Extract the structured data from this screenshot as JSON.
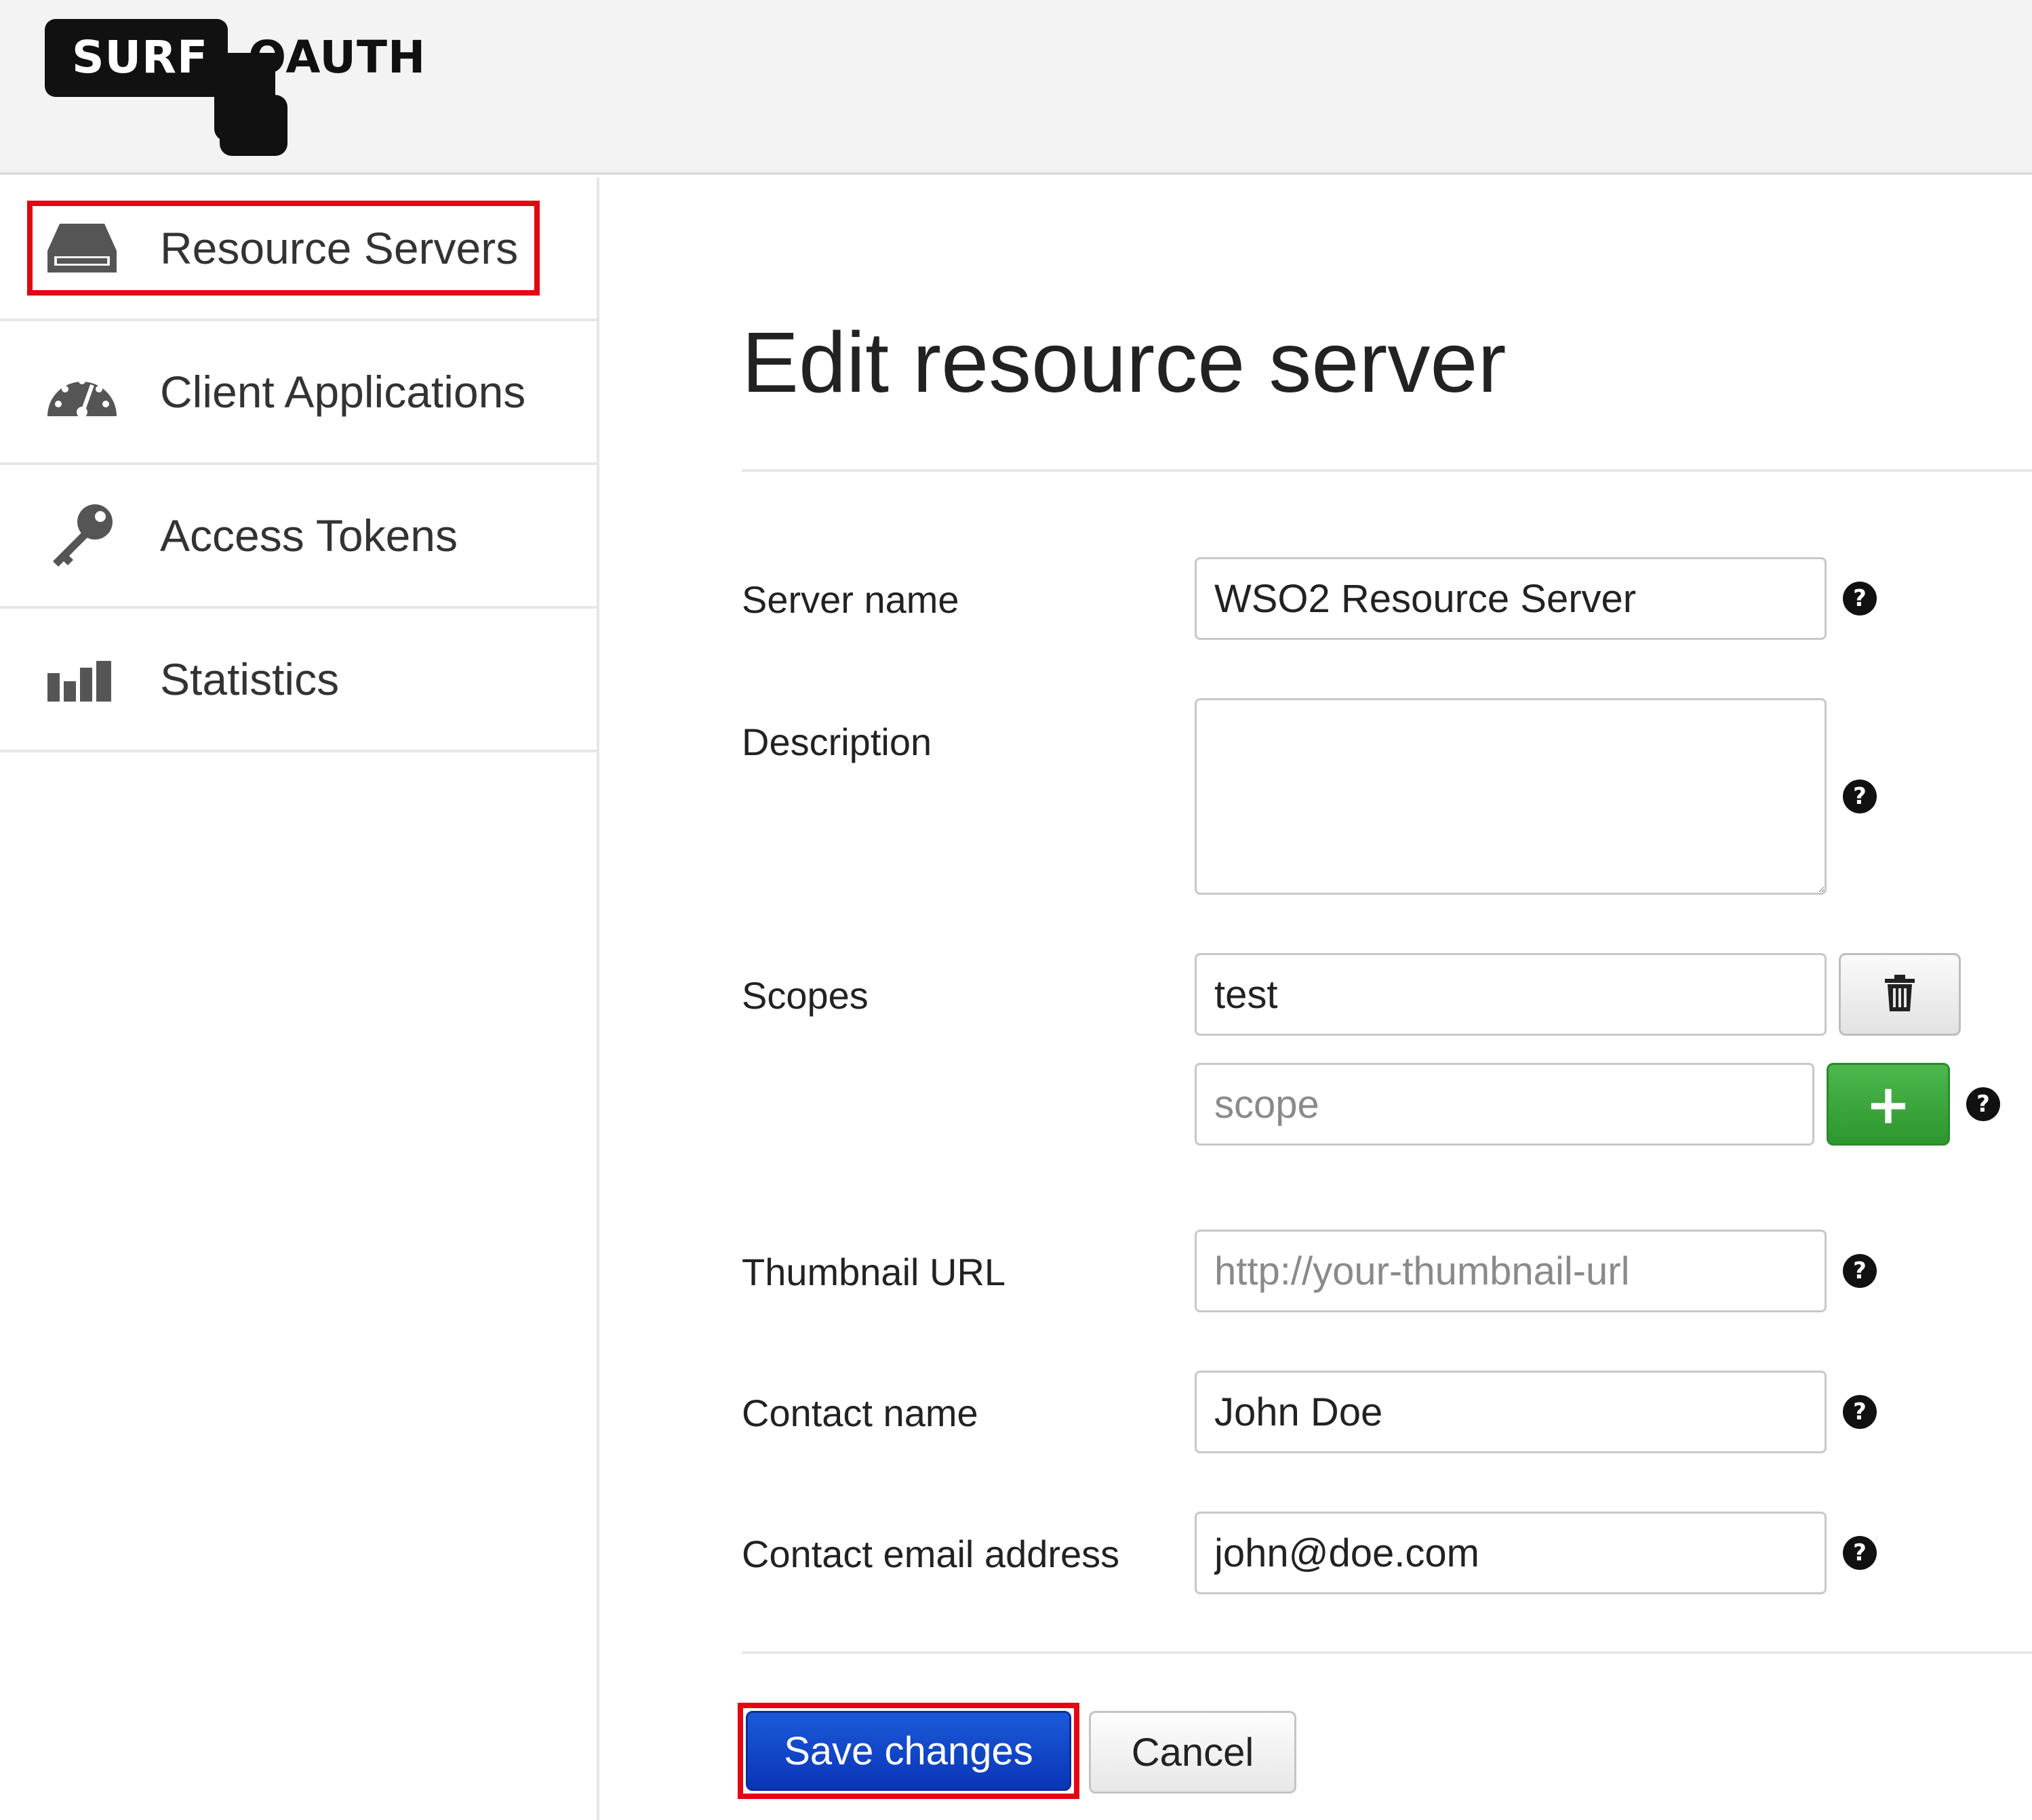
{
  "logo": {
    "left_text": "SURF",
    "right_text": "OAUTH"
  },
  "sidebar": {
    "items": [
      {
        "label": "Resource Servers",
        "icon": "server-icon",
        "highlighted": true
      },
      {
        "label": "Client Applications",
        "icon": "dashboard-icon",
        "highlighted": false
      },
      {
        "label": "Access Tokens",
        "icon": "key-icon",
        "highlighted": false
      },
      {
        "label": "Statistics",
        "icon": "bar-chart-icon",
        "highlighted": false
      }
    ]
  },
  "main": {
    "title": "Edit resource server",
    "form": {
      "server_name": {
        "label": "Server name",
        "value": "WSO2 Resource Server"
      },
      "description": {
        "label": "Description",
        "value": ""
      },
      "scopes": {
        "label": "Scopes",
        "values": [
          "test"
        ],
        "new_placeholder": "scope"
      },
      "thumbnail_url": {
        "label": "Thumbnail URL",
        "value": "",
        "placeholder": "http://your-thumbnail-url"
      },
      "contact_name": {
        "label": "Contact name",
        "value": "John Doe"
      },
      "contact_email": {
        "label": "Contact email address",
        "value": "john@doe.com"
      }
    },
    "help_icon_glyph": "?",
    "add_glyph": "+",
    "save_label": "Save changes",
    "cancel_label": "Cancel"
  },
  "colors": {
    "highlight": "#e30613",
    "primary": "#0a35b8",
    "success": "#2e962e"
  }
}
